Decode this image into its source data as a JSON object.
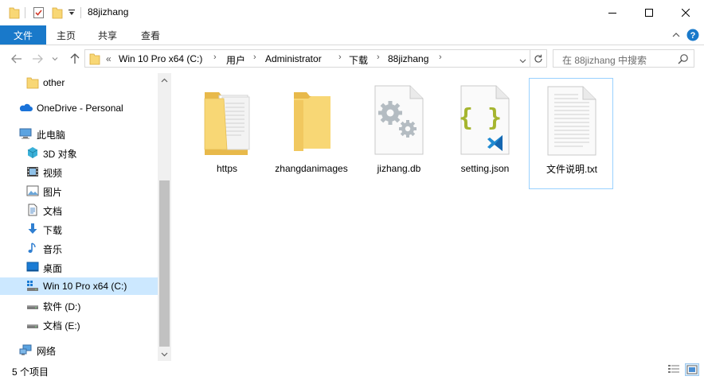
{
  "window": {
    "title": "88jizhang",
    "minimize_icon": "minimize-icon",
    "maximize_icon": "maximize-icon",
    "close_icon": "close-icon"
  },
  "ribbon": {
    "tabs": [
      {
        "label": "文件",
        "active": true
      },
      {
        "label": "主页"
      },
      {
        "label": "共享"
      },
      {
        "label": "查看"
      }
    ],
    "accent": "#1979ca"
  },
  "address": {
    "overflow": "«",
    "crumbs": [
      "Win 10 Pro x64 (C:)",
      "用户",
      "Administrator",
      "下载",
      "88jizhang"
    ]
  },
  "search": {
    "placeholder": "在 88jizhang 中搜索"
  },
  "nav": {
    "items": [
      {
        "label": "other",
        "icon": "folder-icon"
      },
      {
        "label": "OneDrive - Personal",
        "icon": "onedrive-icon"
      },
      {
        "label": "此电脑",
        "icon": "computer-icon"
      },
      {
        "label": "3D 对象",
        "icon": "3d-objects-icon"
      },
      {
        "label": "视频",
        "icon": "video-icon"
      },
      {
        "label": "图片",
        "icon": "pictures-icon"
      },
      {
        "label": "文档",
        "icon": "documents-icon"
      },
      {
        "label": "下载",
        "icon": "download-icon"
      },
      {
        "label": "音乐",
        "icon": "music-icon"
      },
      {
        "label": "桌面",
        "icon": "desktop-icon"
      },
      {
        "label": "Win 10 Pro x64 (C:)",
        "icon": "system-drive-icon",
        "selected": true
      },
      {
        "label": "软件 (D:)",
        "icon": "drive-icon"
      },
      {
        "label": "文档 (E:)",
        "icon": "drive-icon"
      },
      {
        "label": "网络",
        "icon": "network-icon"
      }
    ]
  },
  "files": [
    {
      "name": "https",
      "type": "folder-with-files"
    },
    {
      "name": "zhangdanimages",
      "type": "folder"
    },
    {
      "name": "jizhang.db",
      "type": "settings-file"
    },
    {
      "name": "setting.json",
      "type": "json-file"
    },
    {
      "name": "文件说明.txt",
      "type": "text-file",
      "selected": true
    }
  ],
  "status": {
    "item_count": "5 个项目"
  }
}
